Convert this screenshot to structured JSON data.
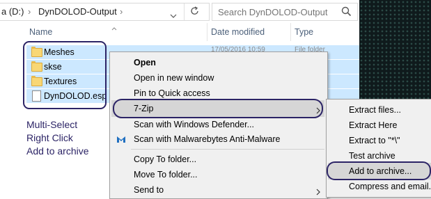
{
  "address": {
    "drive": "a (D:)",
    "sep1": "›",
    "folder": "DynDOLOD-Output",
    "sep2": "›"
  },
  "search": {
    "placeholder": "Search DynDOLOD-Output"
  },
  "columns": {
    "name": "Name",
    "date": "Date modified",
    "type": "Type"
  },
  "files": [
    {
      "name": "Meshes",
      "kind": "folder",
      "date": "17/05/2016 10:59",
      "type": "File folder"
    },
    {
      "name": "skse",
      "kind": "folder",
      "date": "",
      "type": ""
    },
    {
      "name": "Textures",
      "kind": "folder",
      "date": "",
      "type": ""
    },
    {
      "name": "DynDOLOD.esp",
      "kind": "file",
      "date": "",
      "type": ""
    }
  ],
  "notes": [
    "Multi-Select",
    "Right Click",
    "Add to archive"
  ],
  "context_menu": {
    "open": "Open",
    "open_new_window": "Open in new window",
    "pin_quick_access": "Pin to Quick access",
    "sevenzip": "7-Zip",
    "scan_defender": "Scan with Windows Defender...",
    "scan_malwarebytes": "Scan with Malwarebytes Anti-Malware",
    "copy_to_folder": "Copy To folder...",
    "move_to_folder": "Move To folder...",
    "send_to": "Send to"
  },
  "submenu": {
    "extract_files": "Extract files...",
    "extract_here": "Extract Here",
    "extract_to": "Extract to \"*\\\"",
    "test_archive": "Test archive",
    "add_to_archive": "Add to archive...",
    "compress_email": "Compress and email..."
  },
  "colors": {
    "selection": "#cce8ff",
    "annotation": "#2c2466",
    "menu_bg": "#f0f0f0",
    "highlight": "#d6d6d6"
  }
}
